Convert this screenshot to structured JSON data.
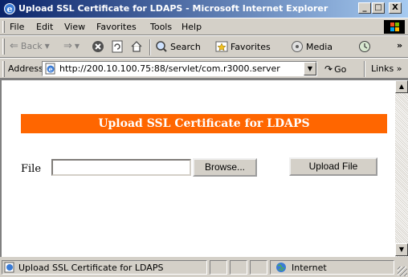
{
  "window": {
    "title": "Upload SSL Certificate for LDAPS - Microsoft Internet Explorer"
  },
  "title_buttons": {
    "minimize": "_",
    "maximize": "□",
    "close": "X"
  },
  "menu": {
    "items": [
      "File",
      "Edit",
      "View",
      "Favorites",
      "Tools",
      "Help"
    ]
  },
  "toolbar": {
    "back": "Back",
    "search": "Search",
    "favorites": "Favorites",
    "media": "Media",
    "more": "»"
  },
  "address": {
    "label": "Address",
    "url": "http://200.10.100.75:88/servlet/com.r3000.server",
    "go": "Go",
    "links": "Links »"
  },
  "page": {
    "banner": "Upload SSL Certificate for LDAPS",
    "file_label": "File",
    "file_value": "",
    "browse_label": "Browse...",
    "upload_label": "Upload File"
  },
  "status": {
    "text": "Upload SSL Certificate for LDAPS",
    "zone": "Internet"
  }
}
